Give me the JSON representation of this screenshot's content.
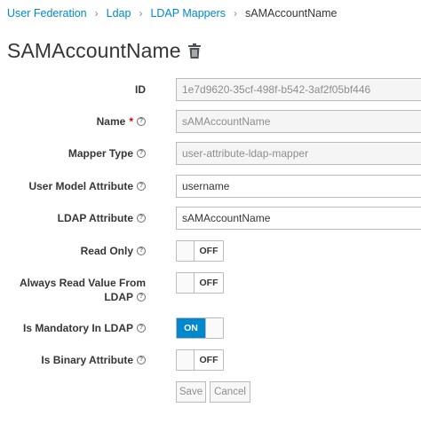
{
  "breadcrumb": {
    "items": [
      "User Federation",
      "Ldap",
      "LDAP Mappers"
    ],
    "current": "sAMAccountName",
    "separator": "›"
  },
  "page": {
    "title": "SAMAccountName"
  },
  "form": {
    "id": {
      "label": "ID",
      "value": "1e7d9620-35cf-498f-b542-3af2f05bf446"
    },
    "name": {
      "label": "Name",
      "required_mark": "*",
      "value": "sAMAccountName"
    },
    "mapper_type": {
      "label": "Mapper Type",
      "value": "user-attribute-ldap-mapper"
    },
    "user_model_attribute": {
      "label": "User Model Attribute",
      "value": "username"
    },
    "ldap_attribute": {
      "label": "LDAP Attribute",
      "value": "sAMAccountName"
    },
    "read_only": {
      "label": "Read Only",
      "state": "OFF"
    },
    "always_read": {
      "label_line1": "Always Read Value From",
      "label_line2": "LDAP",
      "state": "OFF"
    },
    "is_mandatory": {
      "label": "Is Mandatory In LDAP",
      "state": "ON"
    },
    "is_binary": {
      "label": "Is Binary Attribute",
      "state": "OFF"
    }
  },
  "buttons": {
    "save": "Save",
    "cancel": "Cancel"
  },
  "colors": {
    "link": "#0088ce",
    "toggle_on": "#0088ce",
    "required": "#cc0000"
  },
  "icons": {
    "trash": "trash-icon",
    "help": "help-icon"
  }
}
